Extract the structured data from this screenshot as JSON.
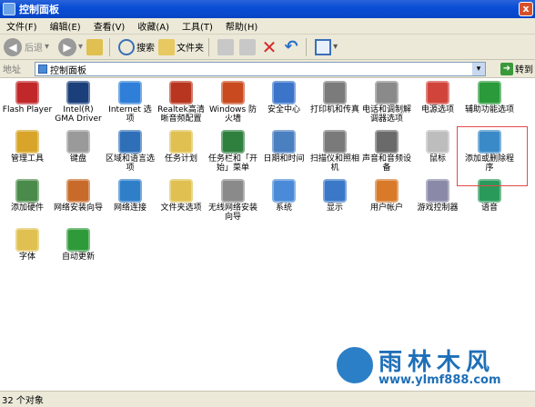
{
  "window": {
    "title": "控制面板",
    "close": "x"
  },
  "menu": [
    "文件(F)",
    "编辑(E)",
    "查看(V)",
    "收藏(A)",
    "工具(T)",
    "帮助(H)"
  ],
  "toolbar": {
    "back": "后退",
    "search": "搜索",
    "folders": "文件夹"
  },
  "address": {
    "label": "地址",
    "value": "控制面板",
    "go": "转到"
  },
  "items": [
    {
      "label": "Flash Player",
      "icon": "flash-player-icon",
      "color": "#c0282a"
    },
    {
      "label": "Intel(R) GMA Driver",
      "icon": "intel-gma-icon",
      "color": "#1b3f7a"
    },
    {
      "label": "Internet 选项",
      "icon": "internet-options-icon",
      "color": "#2f7fd8"
    },
    {
      "label": "Realtek高清晰音频配置",
      "icon": "realtek-audio-icon",
      "color": "#b8361f"
    },
    {
      "label": "Windows 防火墙",
      "icon": "firewall-icon",
      "color": "#c84a1e"
    },
    {
      "label": "安全中心",
      "icon": "security-center-icon",
      "color": "#3b74c9"
    },
    {
      "label": "打印机和传真",
      "icon": "printer-icon",
      "color": "#7b7b7b"
    },
    {
      "label": "电话和调制解调器选项",
      "icon": "phone-modem-icon",
      "color": "#8a8a8a"
    },
    {
      "label": "电源选项",
      "icon": "power-options-icon",
      "color": "#d1443b"
    },
    {
      "label": "辅助功能选项",
      "icon": "accessibility-icon",
      "color": "#2a9a3a"
    },
    {
      "label": "管理工具",
      "icon": "admin-tools-icon",
      "color": "#d8a52a"
    },
    {
      "label": "键盘",
      "icon": "keyboard-icon",
      "color": "#9a9a9a"
    },
    {
      "label": "区域和语言选项",
      "icon": "region-language-icon",
      "color": "#2f6fb8"
    },
    {
      "label": "任务计划",
      "icon": "scheduled-tasks-icon",
      "color": "#e0c050"
    },
    {
      "label": "任务栏和「开始」菜单",
      "icon": "taskbar-start-icon",
      "color": "#2f7f3f"
    },
    {
      "label": "日期和时间",
      "icon": "date-time-icon",
      "color": "#4a7fc0"
    },
    {
      "label": "扫描仪和照相机",
      "icon": "scanner-camera-icon",
      "color": "#7a7a7a"
    },
    {
      "label": "声音和音频设备",
      "icon": "sound-audio-icon",
      "color": "#6a6a6a"
    },
    {
      "label": "鼠标",
      "icon": "mouse-icon",
      "color": "#bdbdbd"
    },
    {
      "label": "添加或删除程序",
      "icon": "add-remove-programs-icon",
      "color": "#3a8ac8"
    },
    {
      "label": "添加硬件",
      "icon": "add-hardware-icon",
      "color": "#4a8a4a"
    },
    {
      "label": "网络安装向导",
      "icon": "network-setup-icon",
      "color": "#c86a2a"
    },
    {
      "label": "网络连接",
      "icon": "network-connections-icon",
      "color": "#2f7fc8"
    },
    {
      "label": "文件夹选项",
      "icon": "folder-options-icon",
      "color": "#e0c050"
    },
    {
      "label": "无线网络安装向导",
      "icon": "wireless-setup-icon",
      "color": "#8a8a8a"
    },
    {
      "label": "系统",
      "icon": "system-icon",
      "color": "#4a8ad8"
    },
    {
      "label": "显示",
      "icon": "display-icon",
      "color": "#3a78c8"
    },
    {
      "label": "用户帐户",
      "icon": "user-accounts-icon",
      "color": "#d87a2a"
    },
    {
      "label": "游戏控制器",
      "icon": "game-controllers-icon",
      "color": "#8a8aa8"
    },
    {
      "label": "语音",
      "icon": "speech-icon",
      "color": "#2a9a5a"
    },
    {
      "label": "字体",
      "icon": "fonts-icon",
      "color": "#e0c050"
    },
    {
      "label": "自动更新",
      "icon": "auto-update-icon",
      "color": "#2f9a3a"
    }
  ],
  "status": "32 个对象",
  "watermark": {
    "title": "雨林木风",
    "url": "www.ylmf888.com"
  }
}
